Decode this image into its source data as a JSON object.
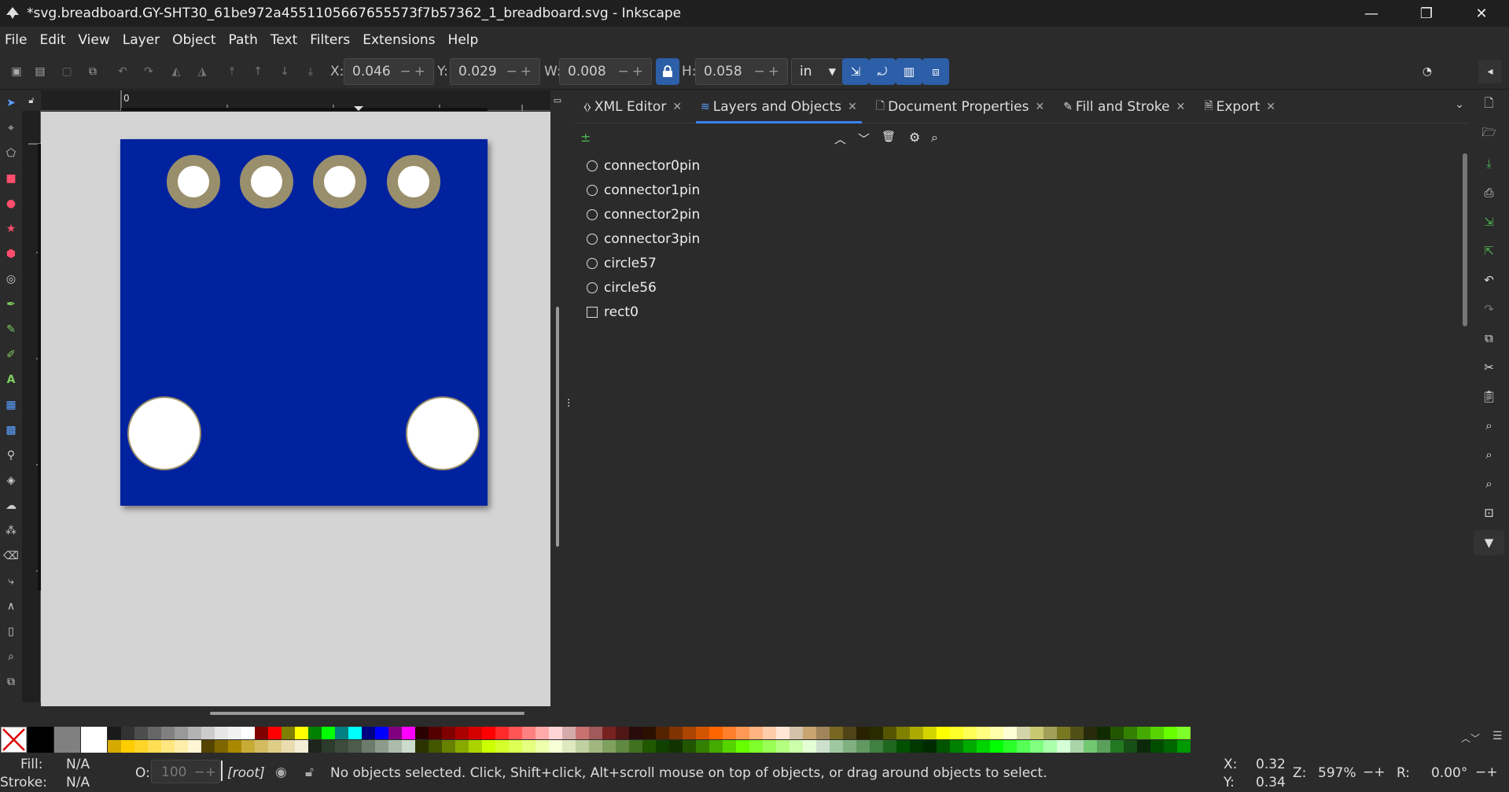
{
  "window": {
    "title": "*svg.breadboard.GY-SHT30_61be972a4551105667655573f7b57362_1_breadboard.svg - Inkscape",
    "minimize": "—",
    "maximize": "❐",
    "close": "✕"
  },
  "menu": [
    "File",
    "Edit",
    "View",
    "Layer",
    "Object",
    "Path",
    "Text",
    "Filters",
    "Extensions",
    "Help"
  ],
  "toolbar": {
    "x_label": "X:",
    "x_value": "0.046",
    "y_label": "Y:",
    "y_value": "0.029",
    "w_label": "W:",
    "w_value": "0.008",
    "h_label": "H:",
    "h_value": "0.058",
    "unit": "in",
    "stepper": "−+"
  },
  "ruler": {
    "origin": "0"
  },
  "canvas": {
    "board_color": "#00209f",
    "pad_color": "#9a8f6c",
    "page_color": "#d4d4d4"
  },
  "dock": {
    "tabs": [
      {
        "label": "XML Editor",
        "icon": "xml-icon"
      },
      {
        "label": "Layers and Objects",
        "icon": "layers-icon"
      },
      {
        "label": "Document Properties",
        "icon": "document-icon"
      },
      {
        "label": "Fill and Stroke",
        "icon": "fill-stroke-icon"
      },
      {
        "label": "Export",
        "icon": "export-icon"
      }
    ],
    "active_tab": "Layers and Objects",
    "objects": [
      {
        "label": "connector0pin",
        "shape": "circle"
      },
      {
        "label": "connector1pin",
        "shape": "circle"
      },
      {
        "label": "connector2pin",
        "shape": "circle"
      },
      {
        "label": "connector3pin",
        "shape": "circle"
      },
      {
        "label": "circle57",
        "shape": "circle"
      },
      {
        "label": "circle56",
        "shape": "circle"
      },
      {
        "label": "rect0",
        "shape": "rect"
      }
    ]
  },
  "status": {
    "fill_label": "Fill:",
    "fill_value": "N/A",
    "stroke_label": "Stroke:",
    "stroke_value": "N/A",
    "opacity_label": "O:",
    "opacity_value": "100",
    "layer": "[root]",
    "message": "No objects selected. Click, Shift+click, Alt+scroll mouse on top of objects, or drag around objects to select.",
    "cursor_x_label": "X:",
    "cursor_x": "0.32",
    "cursor_y_label": "Y:",
    "cursor_y": "0.34",
    "zoom_label": "Z:",
    "zoom": "597%",
    "rotate_label": "R:",
    "rotate": "0.00°"
  },
  "palette": {
    "row1": [
      "#1a1a1a",
      "#333333",
      "#4d4d4d",
      "#666666",
      "#808080",
      "#999999",
      "#b3b3b3",
      "#cccccc",
      "#e6e6e6",
      "#f2f2f2",
      "#ffffff",
      "#800000",
      "#ff0000",
      "#808000",
      "#ffff00",
      "#008000",
      "#00ff00",
      "#008080",
      "#00ffff",
      "#000080",
      "#0000ff",
      "#800080",
      "#ff00ff",
      "#2b0000",
      "#550000",
      "#800000",
      "#aa0000",
      "#d40000",
      "#ff0000",
      "#ff2a2a",
      "#ff5555",
      "#ff8080",
      "#ffaaaa",
      "#ffd5d5",
      "#d4aaaa",
      "#c87171",
      "#a05a5a",
      "#782121",
      "#501616",
      "#280b0b",
      "#2b1100",
      "#552200",
      "#803300",
      "#aa4400",
      "#d45500",
      "#ff6600",
      "#ff7f2a",
      "#ff9955",
      "#ffb380",
      "#ffccaa",
      "#ffe6d5",
      "#d4c2aa",
      "#c8a471",
      "#a0855a",
      "#786721",
      "#504416",
      "#282200",
      "#2b2b00",
      "#555500",
      "#808000",
      "#aaaa00",
      "#d4d400",
      "#ffff00",
      "#ffff2a",
      "#ffff55",
      "#ffff80",
      "#ffffaa",
      "#ffffd5",
      "#d4d4aa",
      "#c8c871",
      "#a0a05a",
      "#787821",
      "#505016",
      "#282b0b",
      "#112b00",
      "#225500",
      "#338000",
      "#44aa00",
      "#55d400",
      "#66ff00",
      "#7fff2a"
    ],
    "row2": [
      "#d4aa00",
      "#ffcc00",
      "#ffd42a",
      "#ffdd55",
      "#ffe680",
      "#ffeeaa",
      "#fff6d5",
      "#554400",
      "#806600",
      "#aa8800",
      "#c8ab37",
      "#d3bc5f",
      "#decd87",
      "#e9ddaf",
      "#f4eed7",
      "#1c241c",
      "#2c3c2c",
      "#3c4c3c",
      "#4c5c4c",
      "#6c7c6c",
      "#8c9c8c",
      "#acbcac",
      "#ccdccc",
      "#2b3300",
      "#445500",
      "#668000",
      "#88aa00",
      "#aad400",
      "#ccff00",
      "#d4ff2a",
      "#ddff55",
      "#e5ff80",
      "#eeffaa",
      "#f6ffd5",
      "#e0e8c0",
      "#c0d0a0",
      "#a0b880",
      "#80a060",
      "#608840",
      "#407020",
      "#205800",
      "#104000",
      "#113300",
      "#225500",
      "#338000",
      "#44aa00",
      "#55d400",
      "#66ff00",
      "#7fff2a",
      "#99ff55",
      "#b3ff80",
      "#ccffaa",
      "#e5ffd5",
      "#cce0cc",
      "#a0c8a0",
      "#80b080",
      "#609860",
      "#408040",
      "#206820",
      "#005000",
      "#003800",
      "#002b00",
      "#005500",
      "#008000",
      "#00aa00",
      "#00d400",
      "#00ff00",
      "#2aff2a",
      "#55ff55",
      "#80ff80",
      "#aaffaa",
      "#d5ffd5",
      "#aad4aa",
      "#71c871",
      "#5aa05a",
      "#217821",
      "#165016",
      "#0b280b",
      "#004d00",
      "#006600",
      "#009900"
    ]
  }
}
